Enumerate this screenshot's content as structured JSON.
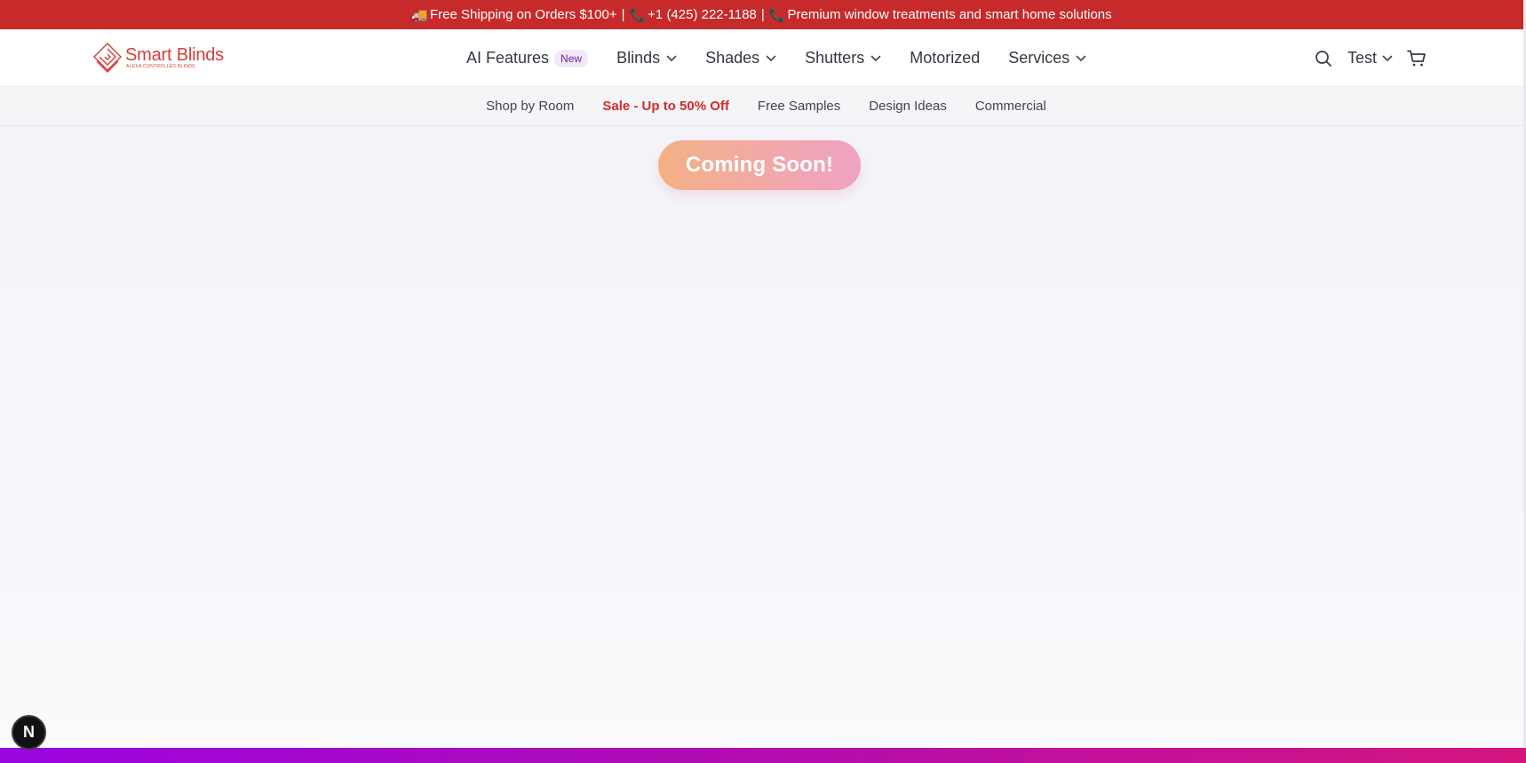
{
  "announcement": {
    "truck_glyph": "🚚",
    "shipping": "Free Shipping on Orders $100+",
    "separator": "|",
    "phone_glyph": "📞",
    "phone": "+1 (425) 222-1188",
    "premium": "Premium window treatments and smart home solutions"
  },
  "brand": {
    "name": "Smart Blinds",
    "tagline": "ALEXA CONTROLLED BLINDS",
    "color": "#d2403c"
  },
  "main_nav": {
    "ai_features": "AI Features",
    "ai_badge": "New",
    "blinds": "Blinds",
    "shades": "Shades",
    "shutters": "Shutters",
    "motorized": "Motorized",
    "services": "Services"
  },
  "header_actions": {
    "search_icon": "search-icon",
    "account_label": "Test",
    "cart_icon": "cart-icon"
  },
  "sub_nav": {
    "shop_by_room": "Shop by Room",
    "sale": "Sale - Up to 50% Off",
    "free_samples": "Free Samples",
    "design_ideas": "Design Ideas",
    "commercial": "Commercial"
  },
  "content": {
    "coming_soon": "Coming Soon!"
  },
  "dev_badge": {
    "letter": "N"
  },
  "colors": {
    "announcement_bg": "#c62a2a",
    "sale_text": "#d42a2a",
    "coming_soon_gradient": [
      "#f3b185",
      "#f0a1c5"
    ],
    "bottom_bar_gradient": [
      "#9a05e0",
      "#d4157e"
    ]
  }
}
